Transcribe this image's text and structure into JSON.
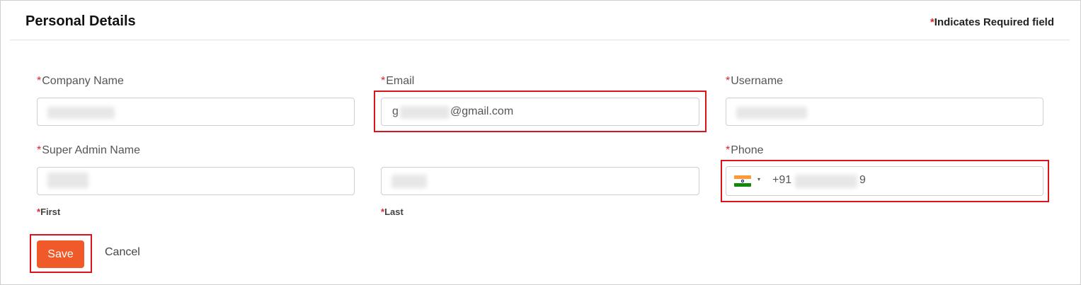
{
  "header": {
    "title": "Personal Details",
    "required_star": "*",
    "required_note": "Indicates Required field"
  },
  "form": {
    "company_name": {
      "star": "*",
      "label": "Company Name",
      "value": ""
    },
    "email": {
      "star": "*",
      "label": "Email",
      "value_prefix": "g",
      "value_suffix": "@gmail.com"
    },
    "username": {
      "star": "*",
      "label": "Username",
      "value": ""
    },
    "super_admin_name": {
      "star": "*",
      "label": "Super Admin Name",
      "first_star": "*",
      "first_label": "First",
      "last_star": "*",
      "last_label": "Last"
    },
    "phone": {
      "star": "*",
      "label": "Phone",
      "country_flag": "india-flag-icon",
      "dropdown_caret": "▾",
      "prefix": "+91",
      "tail": "9"
    }
  },
  "actions": {
    "save_label": "Save",
    "cancel_label": "Cancel"
  },
  "colors": {
    "accent": "#f05a28",
    "required": "#e0242b",
    "highlight": "#d9141b"
  }
}
